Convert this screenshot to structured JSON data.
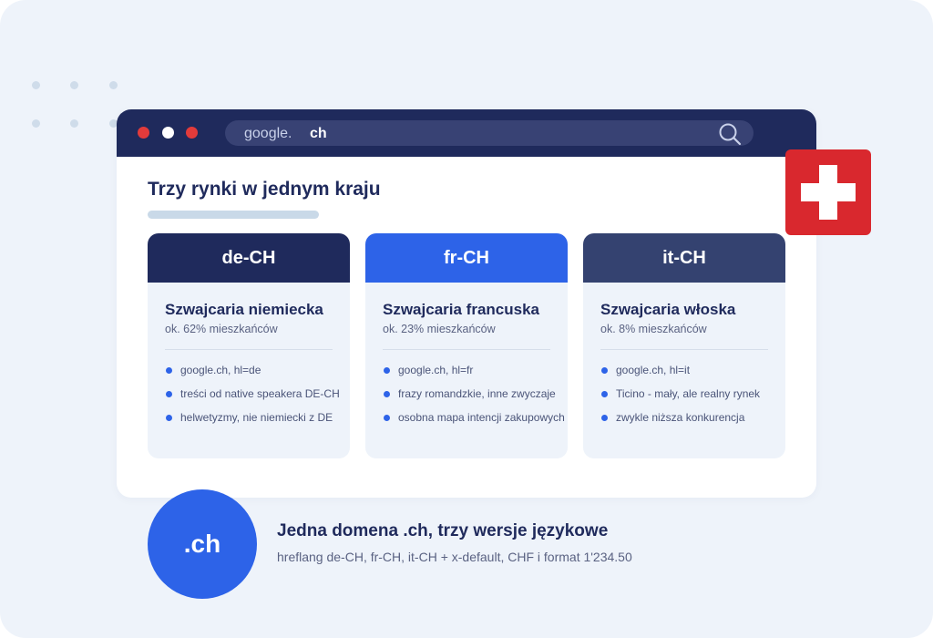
{
  "browser": {
    "window_controls": [
      {
        "name": "close",
        "color": "#e23b3b"
      },
      {
        "name": "minimize",
        "color": "#ffffff"
      },
      {
        "name": "maximize",
        "color": "#e23b3b"
      }
    ],
    "url": {
      "domain": "google.",
      "tld": "ch"
    },
    "search_icon": "search-icon"
  },
  "page": {
    "title": "Trzy rynki w jednym kraju",
    "cards": [
      {
        "code": "de-CH",
        "header_color": "#1f2a5c",
        "title": "Szwajcaria niemiecka",
        "subtitle": "ok. 62% mieszkańców",
        "items": [
          "google.ch, hl=de",
          "treści od native speakera DE-CH",
          "helwetyzmy, nie niemiecki z DE"
        ]
      },
      {
        "code": "fr-CH",
        "header_color": "#2d63e8",
        "title": "Szwajcaria francuska",
        "subtitle": "ok. 23% mieszkańców",
        "items": [
          "google.ch, hl=fr",
          "frazy romandzkie, inne zwyczaje",
          "osobna mapa intencji zakupowych"
        ]
      },
      {
        "code": "it-CH",
        "header_color": "#344270",
        "title": "Szwajcaria włoska",
        "subtitle": "ok. 8% mieszkańców",
        "items": [
          "google.ch, hl=it",
          "Ticino - mały, ale realny rynek",
          "zwykle niższa konkurencja"
        ]
      }
    ]
  },
  "flag": {
    "icon": "swiss-flag-icon",
    "color": "#d9282e"
  },
  "footer": {
    "badge": ".ch",
    "title": "Jedna domena .ch, trzy wersje językowe",
    "subtitle": "hreflang de-CH, fr-CH, it-CH + x-default, CHF i format 1'234.50"
  },
  "colors": {
    "accent": "#2d63e8",
    "navy": "#1f2a5c",
    "background": "#eef3fa"
  }
}
